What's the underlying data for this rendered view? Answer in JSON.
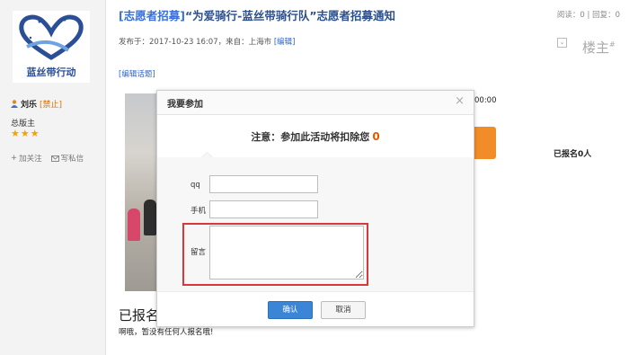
{
  "sidebar": {
    "logo_text": "蓝丝带行动",
    "user_name": "刘乐",
    "ban_label": "[禁止]",
    "role": "总版主",
    "stars": "★★★",
    "follow_label": "加关注",
    "message_label": "写私信"
  },
  "post": {
    "title_tag": "[志愿者招募]",
    "title_rest": "“为爱骑行-蓝丝带骑行队”志愿者招募通知",
    "views": "阅读：0",
    "views_sep": "|",
    "replies": "回复：0",
    "meta_prefix": "发布于：2017-10-23 16:07，来自：上海市 ",
    "meta_edit": "[编辑]",
    "floor": "楼主",
    "edit_topic": "[编辑话题]",
    "time_fragment": "00:00",
    "signed_count": "已报名0人",
    "signed_heading": "已报名",
    "signed_msg": "啊哦，暂没有任何人报名哦!"
  },
  "modal": {
    "title": "我要参加",
    "close": "×",
    "notice_text": "注意：参加此活动将扣除您",
    "notice_value": "0",
    "fields": {
      "qq_label": "qq",
      "phone_label": "手机",
      "message_label": "留言"
    },
    "confirm_label": "确认",
    "cancel_label": "取消"
  },
  "colors": {
    "accent": "#3a85d5",
    "highlight": "#d9383a",
    "warning": "#e05a00",
    "orange_button": "#f28c28"
  }
}
